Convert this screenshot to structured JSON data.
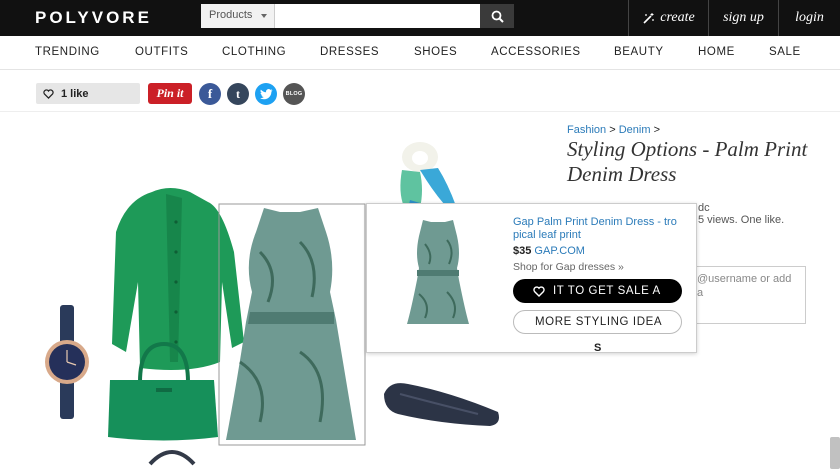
{
  "header": {
    "logo": "POLYVORE",
    "search": {
      "category": "Products",
      "placeholder": ""
    },
    "links": {
      "create": "create",
      "signup": "sign up",
      "login": "login"
    }
  },
  "nav": {
    "items": [
      {
        "label": "TRENDING"
      },
      {
        "label": "OUTFITS"
      },
      {
        "label": "CLOTHING"
      },
      {
        "label": "DRESSES"
      },
      {
        "label": "SHOES"
      },
      {
        "label": "ACCESSORIES"
      },
      {
        "label": "BEAUTY"
      },
      {
        "label": "HOME"
      },
      {
        "label": "SALE"
      }
    ]
  },
  "share": {
    "likes": "1 like",
    "pin_label": "Pin it",
    "facebook_glyph": "f",
    "tumblr_glyph": "t",
    "blog_label": "BLOG"
  },
  "detail": {
    "breadcrumb": {
      "level1": "Fashion",
      "sep": ">",
      "level2": "Denim",
      "trail": ">"
    },
    "title": "Styling Options - Palm Print Denim Dress",
    "meta_fragment_1": "dc",
    "meta_fragment_2": "5 views. One like.",
    "comment_placeholder": "@username or add a"
  },
  "popup": {
    "product_title": "Gap Palm Print Denim Dress - tro pical leaf print",
    "price": "$35",
    "store": "GAP.COM",
    "shop_link": "Shop for Gap dresses »",
    "get_button": "IT TO GET SALE A",
    "more_button": "MORE STYLING IDEA",
    "trailing_text": "S"
  },
  "colors": {
    "topbar": "#111111",
    "link_blue": "#2b7bb9",
    "pinterest": "#cb2027",
    "facebook": "#3b5998",
    "tumblr": "#35465c",
    "twitter": "#1da1f2",
    "cardigan": "#1e9a58",
    "bag": "#16905a",
    "dress": "#6f9a92",
    "watch_strap": "#2a3a5a",
    "flat_shoe": "#2c3446"
  }
}
